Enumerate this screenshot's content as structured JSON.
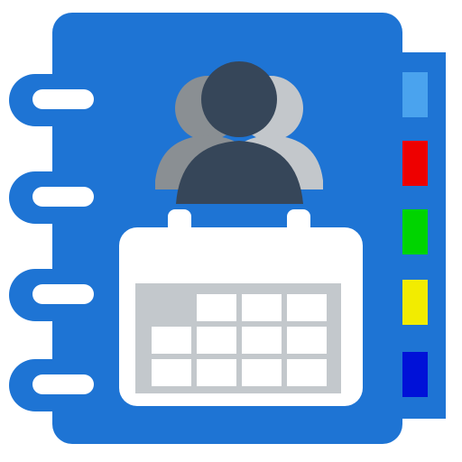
{
  "icon": {
    "name": "contacts-calendar-app-icon",
    "colors": {
      "cover": "#1e74d4",
      "spine": "#1e74d4",
      "ring": "#1e74d4",
      "ring_hole": "#ffffff",
      "person_front": "#364659",
      "person_left": "#8a8f93",
      "person_right": "#c3c7cb",
      "calendar_body": "#ffffff",
      "calendar_grid": "#c3c8cc",
      "calendar_cell": "#ffffff"
    },
    "tabs": [
      {
        "name": "light-blue-tab",
        "color": "#4aa3ee"
      },
      {
        "name": "red-tab",
        "color": "#ee0000"
      },
      {
        "name": "green-tab",
        "color": "#00d400"
      },
      {
        "name": "yellow-tab",
        "color": "#f2ec00"
      },
      {
        "name": "blue-tab",
        "color": "#0011d8"
      }
    ]
  }
}
